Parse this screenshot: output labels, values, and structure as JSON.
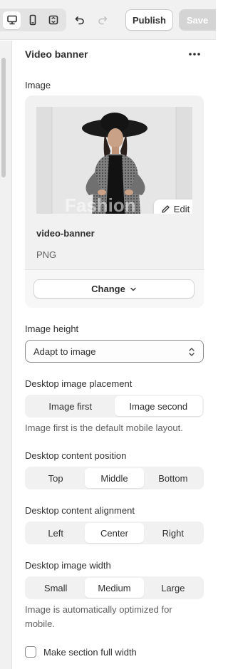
{
  "toolbar": {
    "publish_label": "Publish",
    "save_label": "Save",
    "device_buttons": [
      {
        "icon": "desktop-icon",
        "active": true
      },
      {
        "icon": "mobile-icon",
        "active": false
      },
      {
        "icon": "fullscreen-icon",
        "active": false
      }
    ]
  },
  "panel": {
    "title": "Video banner",
    "more_icon": "more-horizontal-icon"
  },
  "image_section": {
    "label": "Image",
    "file_name": "video-banner",
    "file_type": "PNG",
    "edit_label": "Edit",
    "change_label": "Change",
    "thumbnail_watermark": "Fashion"
  },
  "image_height": {
    "label": "Image height",
    "value": "Adapt to image"
  },
  "image_placement": {
    "label": "Desktop image placement",
    "options": [
      "Image first",
      "Image second"
    ],
    "selected": "Image second",
    "help": "Image first is the default mobile layout."
  },
  "content_position": {
    "label": "Desktop content position",
    "options": [
      "Top",
      "Middle",
      "Bottom"
    ],
    "selected": "Middle"
  },
  "content_alignment": {
    "label": "Desktop content alignment",
    "options": [
      "Left",
      "Center",
      "Right"
    ],
    "selected": "Center"
  },
  "image_width": {
    "label": "Desktop image width",
    "options": [
      "Small",
      "Medium",
      "Large"
    ],
    "selected": "Medium",
    "help": "Image is automatically optimized for mobile."
  },
  "full_width": {
    "label": "Make section full width",
    "checked": false
  },
  "colors": {
    "toolbar_bg": "#f1f1f1",
    "text": "#303030",
    "muted_text": "#616161",
    "save_disabled": "#d4d4d4"
  }
}
